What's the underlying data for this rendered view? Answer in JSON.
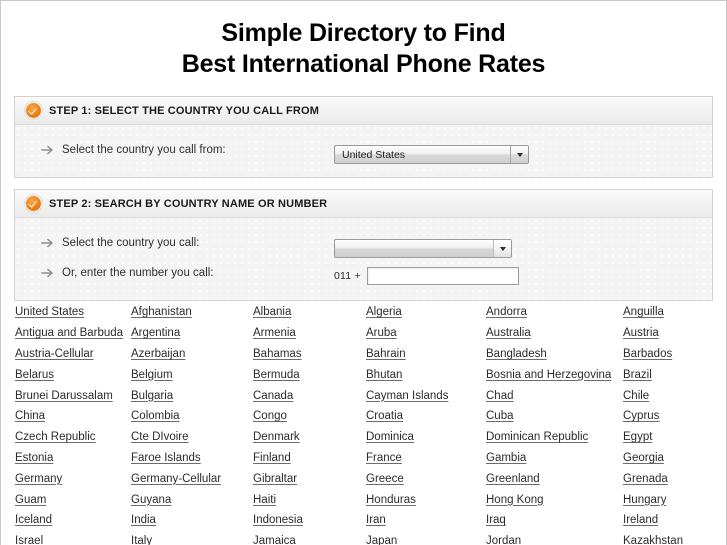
{
  "page": {
    "title_lines": [
      "Simple Directory to Find",
      "Best International Phone Rates"
    ]
  },
  "colors": {
    "accent_orange": "#ef8418",
    "panel_bg": "#f4f4f4",
    "panel_header_bg": "#f2f2f2",
    "link_text": "#2b2b2b",
    "page_bg": "#ffffff",
    "border": "#d2d2d2"
  },
  "step1": {
    "icon": "orange-check-icon",
    "header": "STEP 1: SELECT THE COUNTRY YOU CALL FROM",
    "row": {
      "bullet_icon": "arrow-right-icon",
      "label": "Select the country you call from:",
      "select": {
        "name": "country-from-select",
        "value": "United States",
        "caret_icon": "chevron-down-icon"
      }
    }
  },
  "step2": {
    "icon": "orange-check-icon",
    "header": "STEP 2: SEARCH BY COUNTRY NAME OR NUMBER",
    "row_select": {
      "bullet_icon": "arrow-right-icon",
      "label": "Select the country you call:",
      "select": {
        "name": "country-to-select",
        "value": "",
        "caret_icon": "chevron-down-icon"
      }
    },
    "row_number": {
      "bullet_icon": "arrow-right-icon",
      "label": "Or, enter the number you call:",
      "prefix": "011 +",
      "input": {
        "name": "phone-number-input",
        "value": "",
        "placeholder": ""
      }
    }
  },
  "country_grid": {
    "columns": 6,
    "rows": [
      [
        "United States",
        "Afghanistan",
        "Albania",
        "Algeria",
        "Andorra",
        "Anguilla"
      ],
      [
        "Antigua and Barbuda",
        "Argentina",
        "Armenia",
        "Aruba",
        "Australia",
        "Austria"
      ],
      [
        "Austria-Cellular",
        "Azerbaijan",
        "Bahamas",
        "Bahrain",
        "Bangladesh",
        "Barbados"
      ],
      [
        "Belarus",
        "Belgium",
        "Bermuda",
        "Bhutan",
        "Bosnia and Herzegovina",
        "Brazil"
      ],
      [
        "Brunei Darussalam",
        "Bulgaria",
        "Canada",
        "Cayman Islands",
        "Chad",
        "Chile"
      ],
      [
        "China",
        "Colombia",
        "Congo",
        "Croatia",
        "Cuba",
        "Cyprus"
      ],
      [
        "Czech Republic",
        "Cte DIvoire",
        "Denmark",
        "Dominica",
        "Dominican Republic",
        "Egypt"
      ],
      [
        "Estonia",
        "Faroe Islands",
        "Finland",
        "France",
        "Gambia",
        "Georgia"
      ],
      [
        "Germany",
        "Germany-Cellular",
        "Gibraltar",
        "Greece",
        "Greenland",
        "Grenada"
      ],
      [
        "Guam",
        "Guyana",
        "Haiti",
        "Honduras",
        "Hong Kong",
        "Hungary"
      ],
      [
        "Iceland",
        "India",
        "Indonesia",
        "Iran",
        "Iraq",
        "Ireland"
      ],
      [
        "Israel",
        "Italy",
        "Jamaica",
        "Japan",
        "Jordan",
        "Kazakhstan"
      ]
    ]
  }
}
